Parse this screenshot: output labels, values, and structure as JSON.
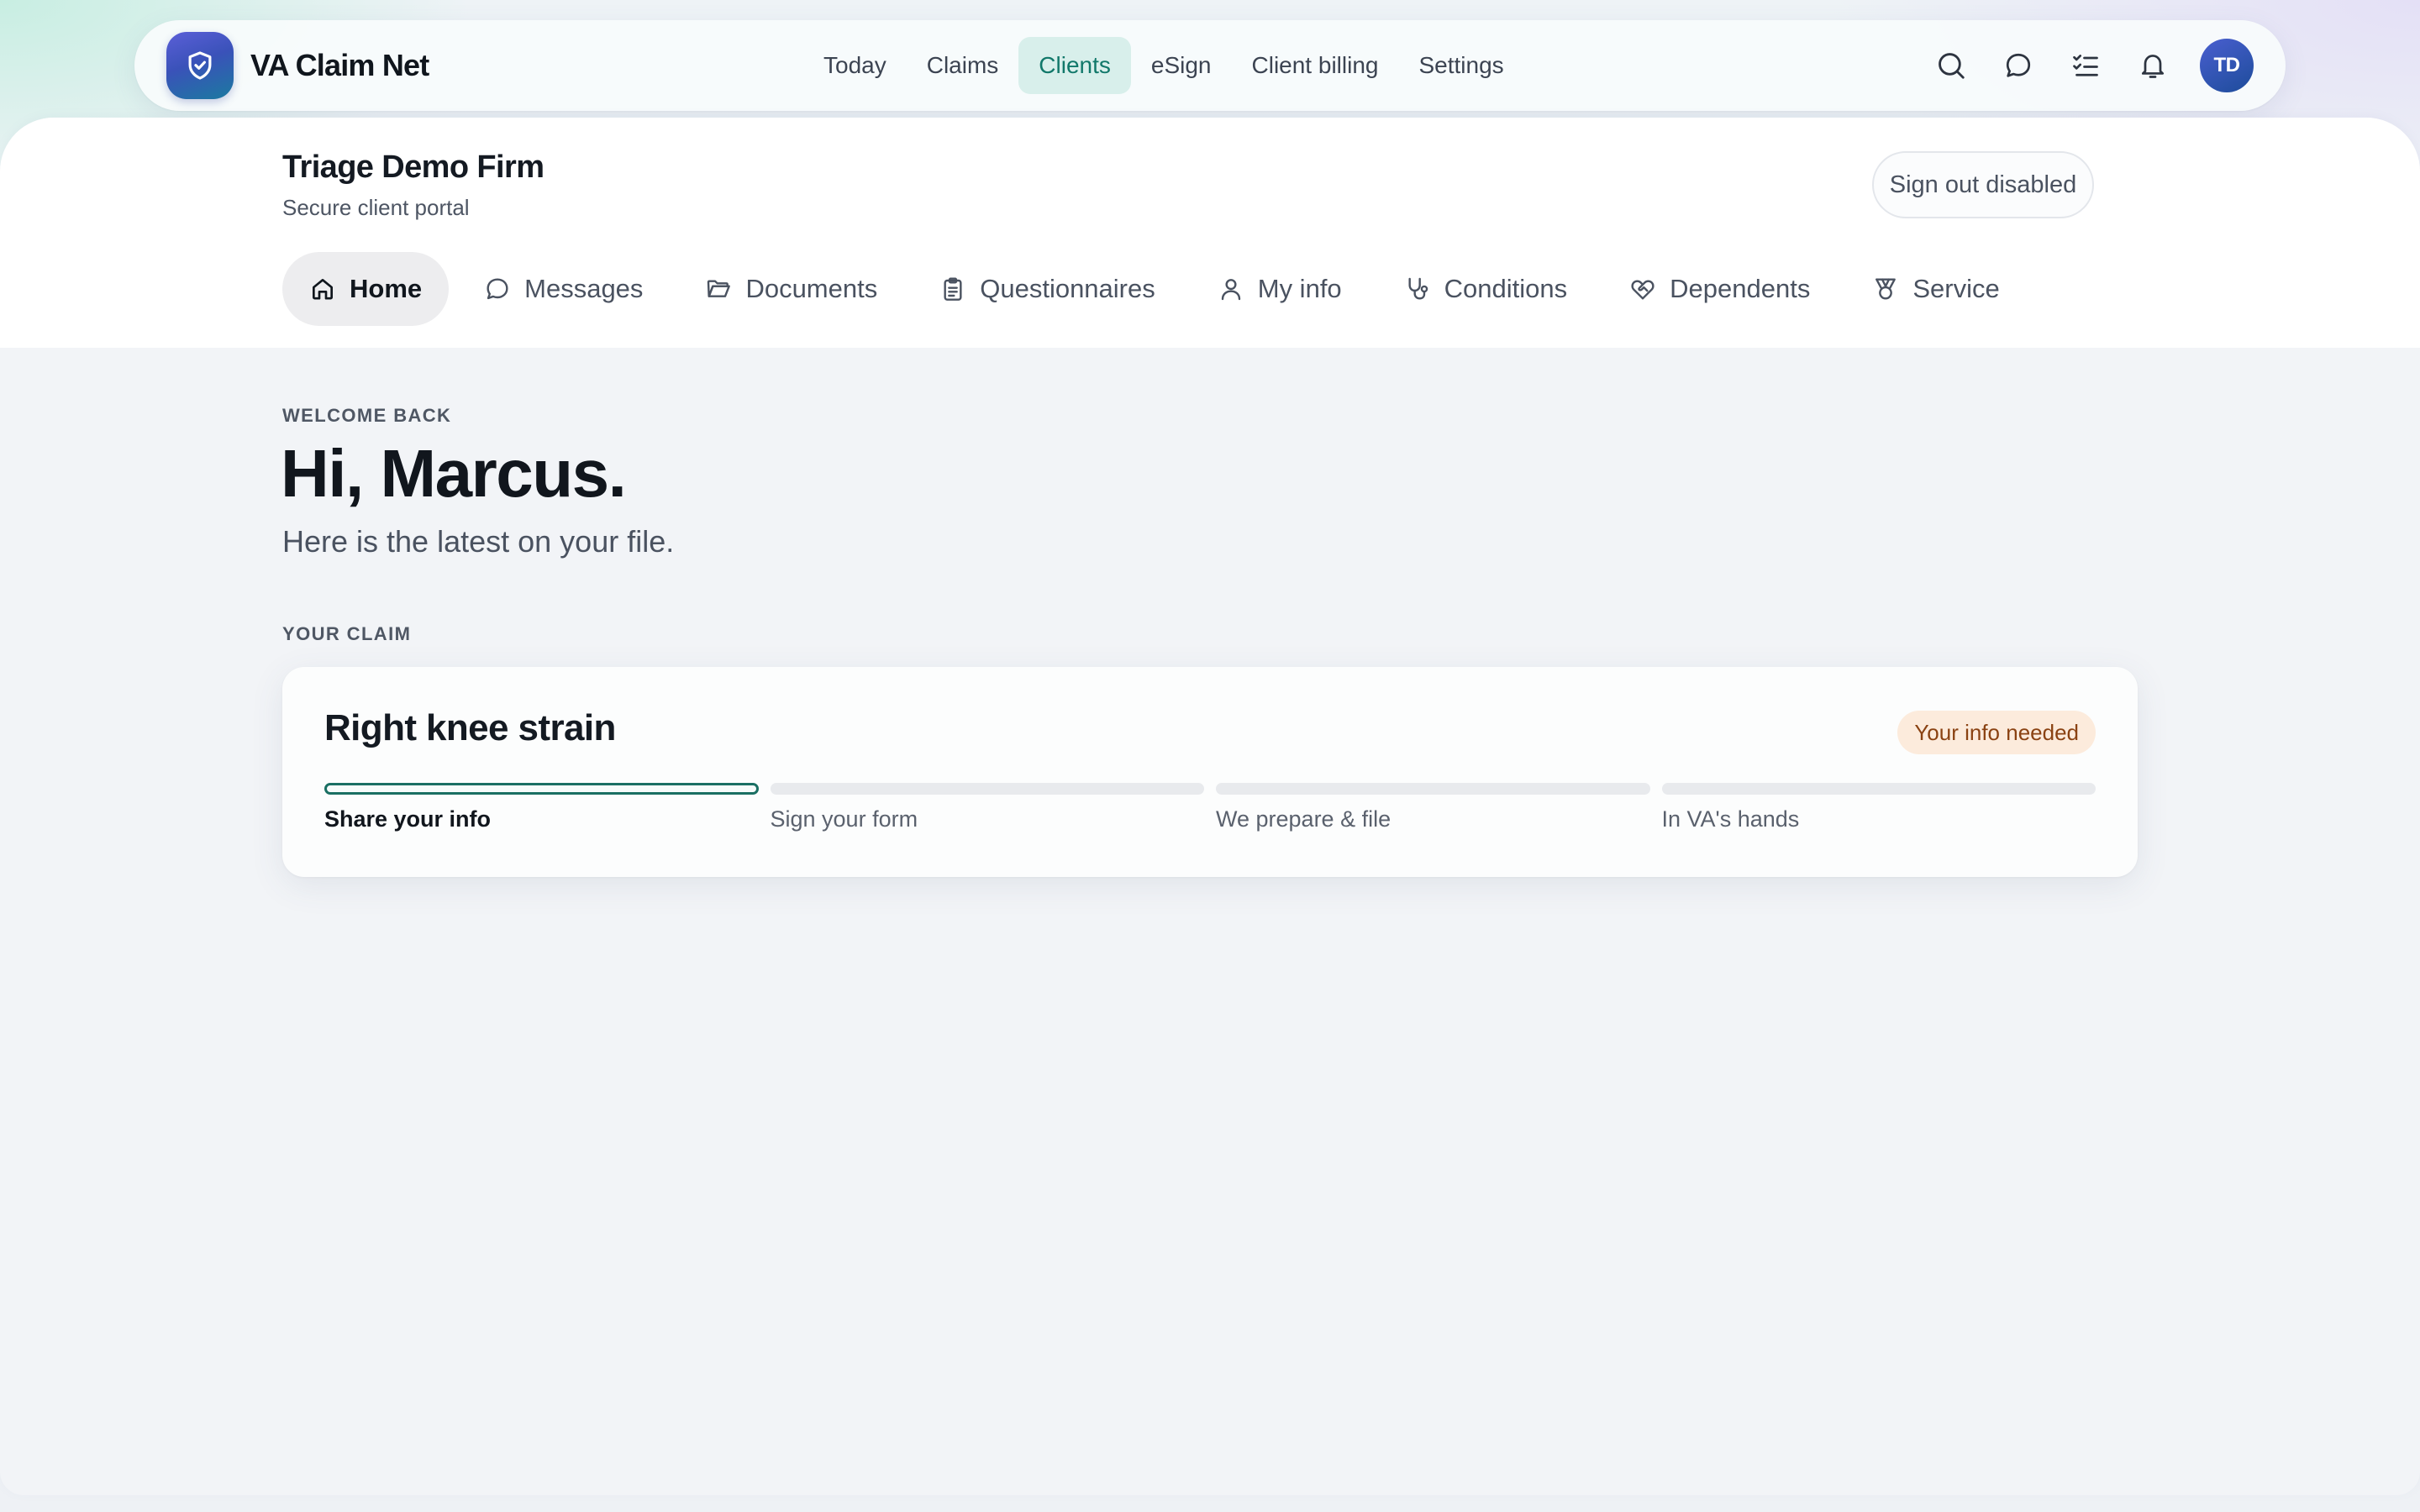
{
  "app": {
    "name": "VA Claim Net",
    "logo_icon": "shield-check-icon"
  },
  "topnav": {
    "links": [
      {
        "label": "Today",
        "active": false
      },
      {
        "label": "Claims",
        "active": false
      },
      {
        "label": "Clients",
        "active": true
      },
      {
        "label": "eSign",
        "active": false
      },
      {
        "label": "Client billing",
        "active": false
      },
      {
        "label": "Settings",
        "active": false
      }
    ],
    "icons": [
      "search-icon",
      "chat-icon",
      "checklist-icon",
      "bell-icon"
    ],
    "avatar_initials": "TD"
  },
  "portal": {
    "firm_name": "Triage Demo Firm",
    "subtitle": "Secure client portal",
    "signout_label": "Sign out disabled",
    "tabs": [
      {
        "label": "Home",
        "icon": "home-icon",
        "active": true
      },
      {
        "label": "Messages",
        "icon": "message-icon",
        "active": false
      },
      {
        "label": "Documents",
        "icon": "folder-icon",
        "active": false
      },
      {
        "label": "Questionnaires",
        "icon": "clipboard-icon",
        "active": false
      },
      {
        "label": "My info",
        "icon": "user-icon",
        "active": false
      },
      {
        "label": "Conditions",
        "icon": "stethoscope-icon",
        "active": false
      },
      {
        "label": "Dependents",
        "icon": "heart-handshake-icon",
        "active": false
      },
      {
        "label": "Service",
        "icon": "medal-icon",
        "active": false
      }
    ]
  },
  "welcome": {
    "eyebrow": "WELCOME BACK",
    "greeting": "Hi, Marcus.",
    "subtitle": "Here is the latest on your file."
  },
  "claim": {
    "section_label": "YOUR CLAIM",
    "title": "Right knee strain",
    "status_badge": "Your info needed",
    "steps": [
      {
        "label": "Share your info",
        "current": true
      },
      {
        "label": "Sign your form",
        "current": false
      },
      {
        "label": "We prepare & file",
        "current": false
      },
      {
        "label": "In VA's hands",
        "current": false
      }
    ]
  },
  "colors": {
    "accent_teal": "#11786a",
    "brand_blue": "#3a52b9",
    "badge_bg": "#fcebdc",
    "badge_text": "#8a4212"
  }
}
